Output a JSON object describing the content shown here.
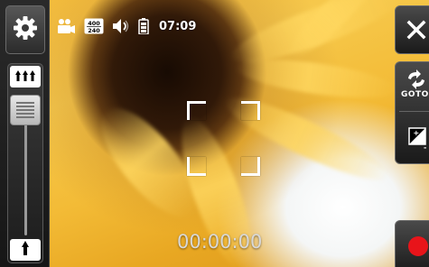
{
  "status": {
    "time": "07:09",
    "resolution_top": "400",
    "resolution_bottom": "240"
  },
  "recording": {
    "timer": "00:00:00"
  },
  "right_panel": {
    "goto_label": "GOTO"
  },
  "colors": {
    "record_red": "#e8141a",
    "bar_dark": "#1c1c1c"
  },
  "icons": {
    "settings": "gear-icon",
    "video_mode": "video-camera-icon",
    "resolution": "resolution-icon",
    "audio": "speaker-icon",
    "battery": "battery-icon",
    "zoom_in": "zoom-in-icon",
    "zoom_out": "zoom-out-icon",
    "close": "close-icon",
    "goto": "goto-gallery-icon",
    "exposure": "exposure-icon",
    "record": "record-icon"
  },
  "zoom": {
    "level": 0.85
  }
}
